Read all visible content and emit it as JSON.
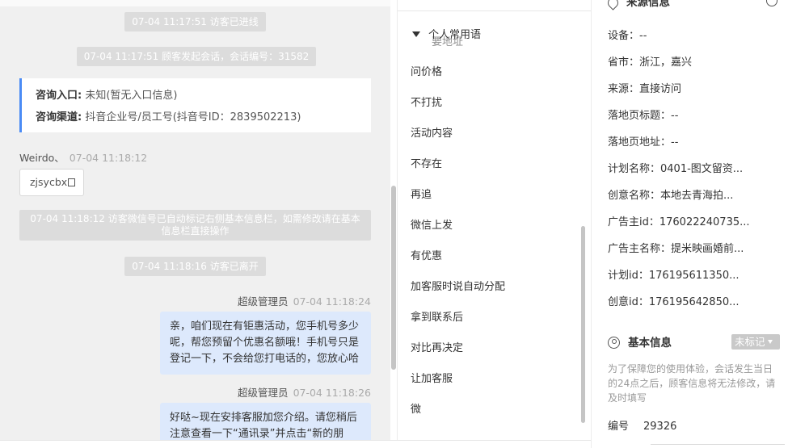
{
  "chat": {
    "sys1": "07-04 11:17:51 访客已进线",
    "sys2": "07-04 11:17:51 顾客发起会话，会话编号：31582",
    "entry_label": "咨询入口:",
    "entry_value": "未知(暂无入口信息)",
    "channel_label": "咨询渠道:",
    "channel_value": "抖音企业号/员工号(抖音号ID：2839502213)",
    "visitor_name": "Weirdo、",
    "visitor_time": "07-04 11:18:12",
    "visitor_tag": "zjsycbx",
    "sys3": "07-04 11:18:12 访客微信号已自动标记右侧基本信息栏，如需修改请在基本信息栏直接操作",
    "sys4": "07-04 11:18:16 访客已离开",
    "agent_name_1": "超级管理员",
    "agent_time_1": "07-04 11:18:24",
    "msg_1": "亲，咱们现在有钜惠活动，您手机号多少呢，帮您预留个优惠名额哦！手机号只是登记一下，不会给您打电话的，您放心哈",
    "agent_name_2": "超级管理员",
    "agent_time_2": "07-04 11:18:26",
    "msg_2": "好哒~现在安排客服加您介绍。请您稍后注意查看一下“通讯录”并点击“新的朋"
  },
  "phrases": {
    "header": "个人常用语",
    "ghost": "要地址",
    "items": [
      "问价格",
      "不打扰",
      "活动内容",
      "不存在",
      "再追",
      "微信上发",
      "有优惠",
      "加客服时说自动分配",
      "拿到联系后",
      "对比再决定",
      "让加客服",
      "微"
    ]
  },
  "source_info": {
    "title": "来源信息",
    "rows": [
      "设备：--",
      "省市：浙江，嘉兴",
      "来源：直接访问",
      "落地页标题：--",
      "落地页地址：--",
      "计划名称：0401-图文留资...",
      "创意名称：本地去青海拍...",
      "广告主id：176022240735...",
      "广告主名称：提米映画婚前...",
      "计划id：176195611350...",
      "创意id：176195642850..."
    ]
  },
  "basic_info": {
    "title": "基本信息",
    "mark_label": "未标记",
    "note": "为了保障您的使用体验，会话发生当日的24点之后，顾客信息将无法修改，请及时填写",
    "number_label": "编号",
    "number_value": "29326"
  },
  "colors": {
    "accent": "#4a8bf5",
    "agent_bubble": "#dde9fc",
    "system_pill": "#dcdcdc",
    "chat_bg": "#f0f0f0"
  }
}
